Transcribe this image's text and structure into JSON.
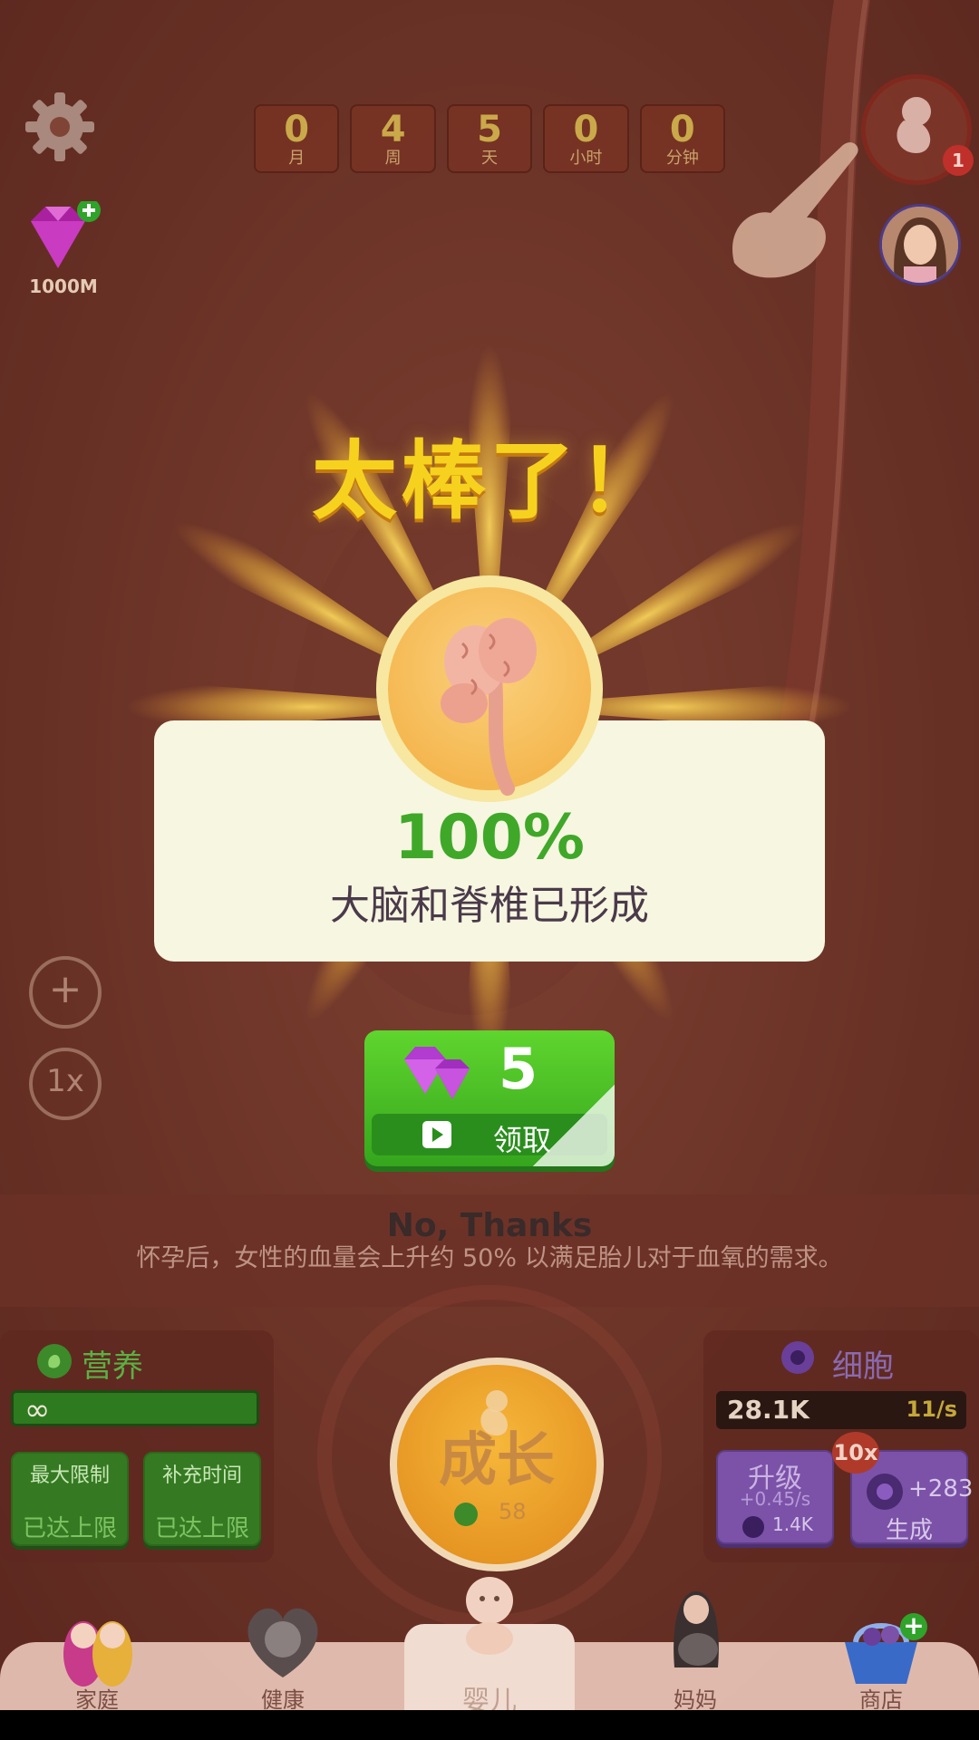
{
  "timer": [
    {
      "value": "0",
      "unit": "月"
    },
    {
      "value": "4",
      "unit": "周"
    },
    {
      "value": "5",
      "unit": "天"
    },
    {
      "value": "0",
      "unit": "小时"
    },
    {
      "value": "0",
      "unit": "分钟"
    }
  ],
  "gems": {
    "count": "1000M"
  },
  "embryo_badge": "1",
  "speed": "1x",
  "popup": {
    "headline": "太棒了！",
    "percent": "100%",
    "description": "大脑和脊椎已形成",
    "reward_amount": "5",
    "claim_label": "领取",
    "decline_label": "No, Thanks"
  },
  "tip": "怀孕后，女性的血量会上升约 50% 以满足胎儿对于血氧的需求。",
  "nutrition": {
    "title": "营养",
    "bar_value": "∞",
    "max_limit_label": "最大限制",
    "max_limit_status": "已达上限",
    "refill_label": "补充时间",
    "refill_status": "已达上限"
  },
  "grow": {
    "label": "成长",
    "cost": "58"
  },
  "cells": {
    "title": "细胞",
    "count": "28.1K",
    "rate": "11/s",
    "upgrade_label": "升级",
    "upgrade_sub": "+0.45/s",
    "upgrade_cost": "1.4K",
    "multiplier": "10x",
    "produce_amount": "+283",
    "produce_label": "生成"
  },
  "nav": [
    {
      "label": "家庭",
      "icon": "twins-icon"
    },
    {
      "label": "健康",
      "icon": "heart-baby-icon"
    },
    {
      "label": "婴儿",
      "icon": "baby-icon"
    },
    {
      "label": "妈妈",
      "icon": "mother-icon"
    },
    {
      "label": "商店",
      "icon": "basket-icon"
    }
  ],
  "colors": {
    "headline": "#f6d21e",
    "percent": "#3fa829",
    "claim_button": "#4cc425",
    "card": "#f7f6e1"
  }
}
